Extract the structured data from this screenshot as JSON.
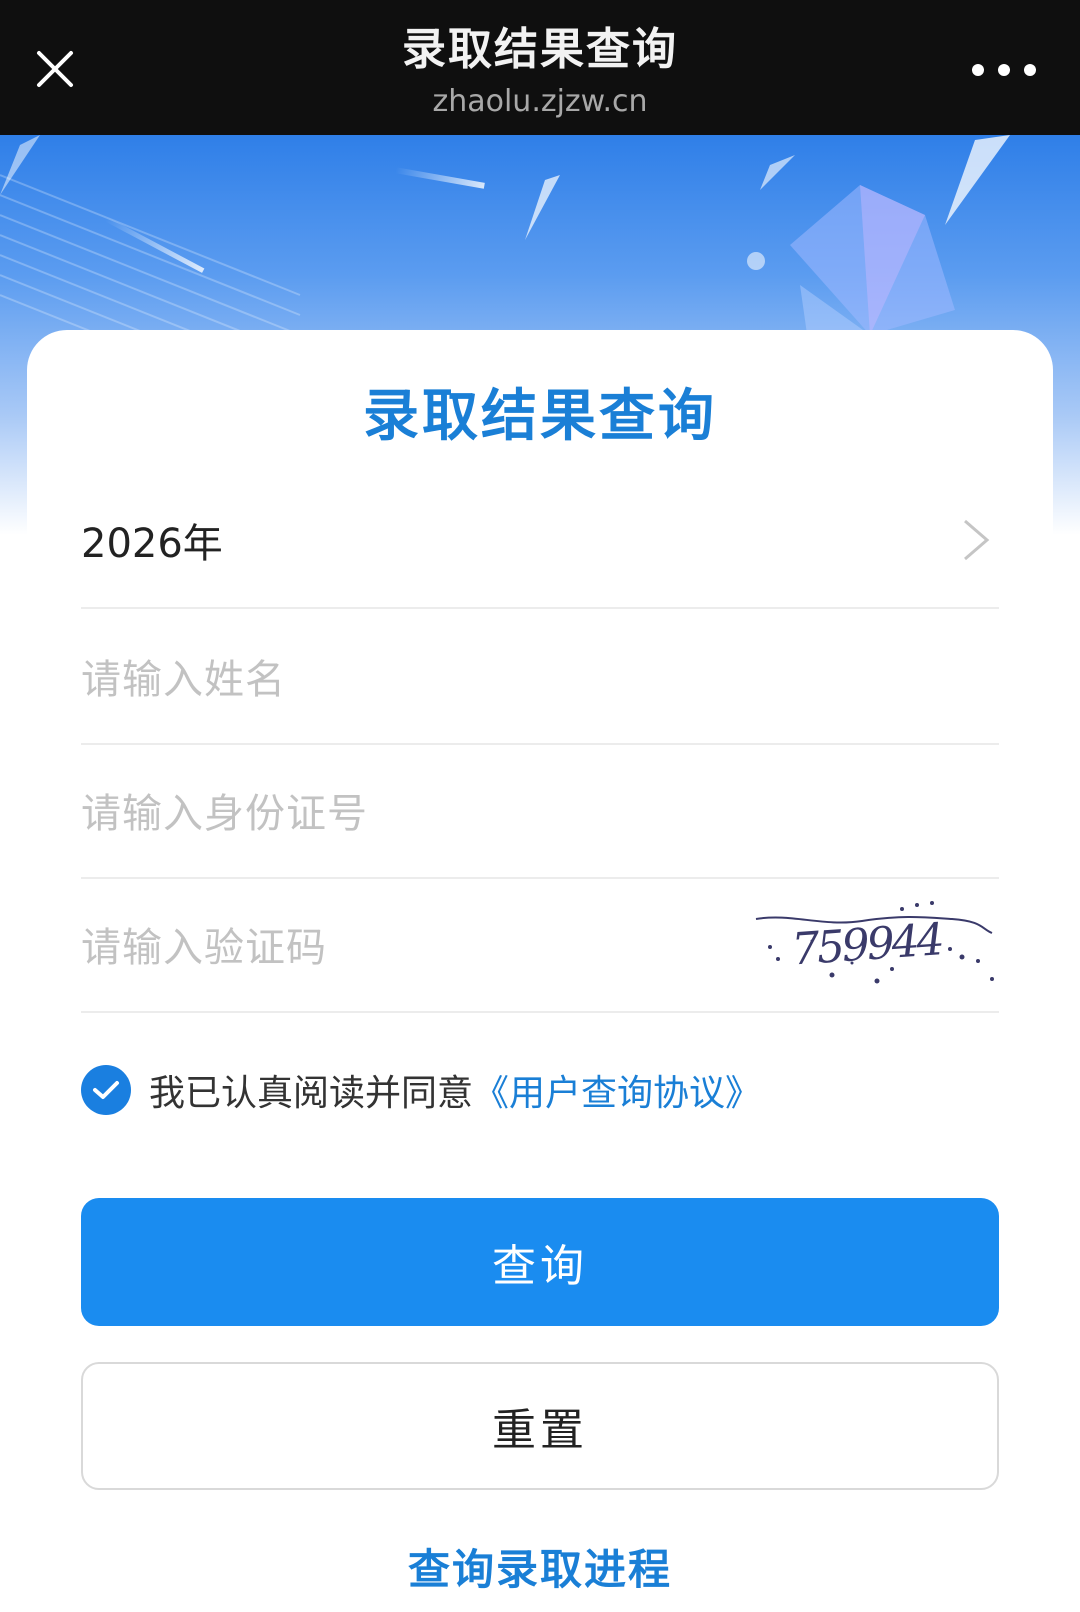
{
  "nav": {
    "title": "录取结果查询",
    "url": "zhaolu.zjzw.cn",
    "close_icon": "close-icon",
    "more_icon": "more-dots-icon"
  },
  "form": {
    "heading": "录取结果查询",
    "year_value": "2026年",
    "name_placeholder": "请输入姓名",
    "id_placeholder": "请输入身份证号",
    "captcha_placeholder": "请输入验证码",
    "captcha_text": "759944",
    "agree_checked": true,
    "agree_text": "我已认真阅读并同意",
    "agree_link": "《用户查询协议》",
    "query_button": "查询",
    "reset_button": "重置",
    "progress_link": "查询录取进程"
  },
  "colors": {
    "accent": "#1a8cf0",
    "link": "#1a7fd6",
    "topbar": "#0f0f0f"
  }
}
